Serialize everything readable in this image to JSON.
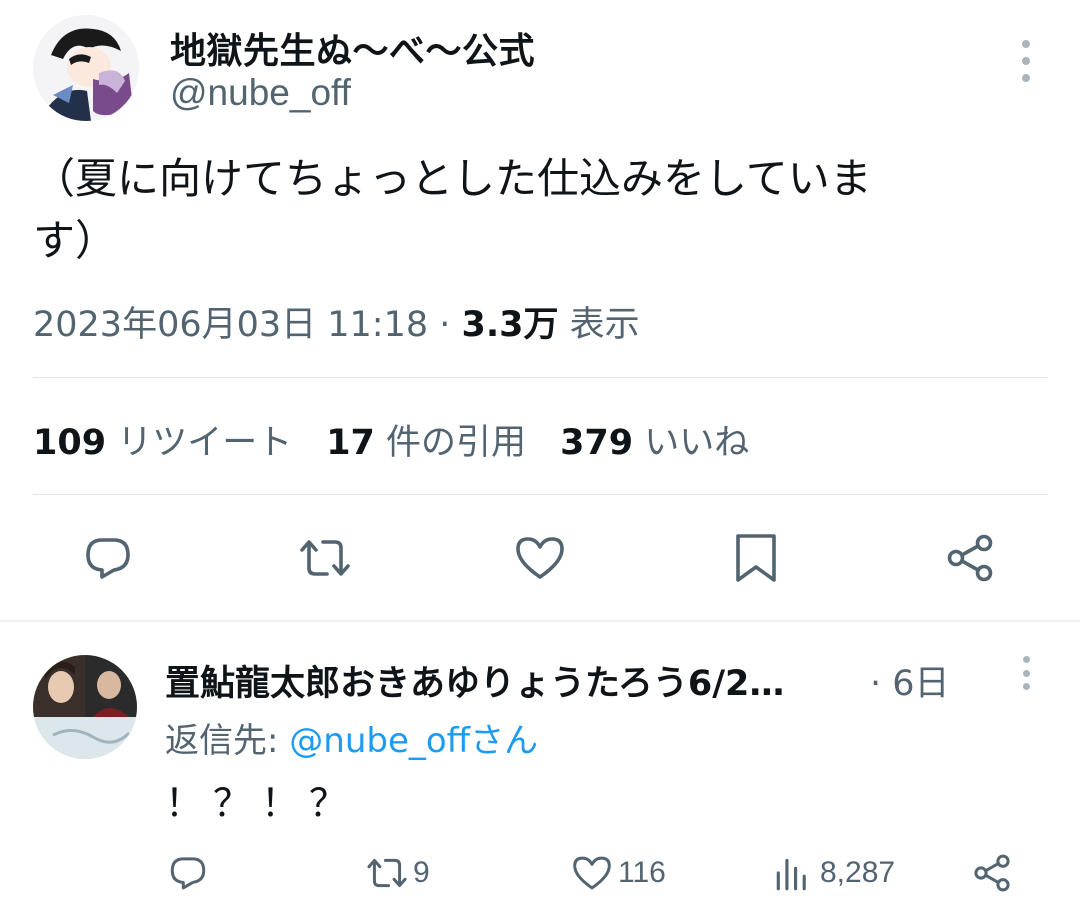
{
  "main_tweet": {
    "display_name": "地獄先生ぬ〜べ〜公式",
    "handle": "@nube_off",
    "text_line1": "（夏に向けてちょっとした仕込みをしていま",
    "text_line2": "す）",
    "datetime": "2023年06月03日 11:18",
    "separator": " · ",
    "views_count": "3.3万",
    "views_label": " 表示",
    "stats": {
      "retweets_count": "109",
      "retweets_label": " リツイート",
      "quotes_count": "17",
      "quotes_label": " 件の引用",
      "likes_count": "379",
      "likes_label": " いいね"
    },
    "actions": [
      "reply-icon",
      "retweet-icon",
      "like-icon",
      "bookmark-icon",
      "share-icon"
    ]
  },
  "reply_tweet": {
    "display_name": "置鮎龍太郎おきあゆりょうたろう6/2…",
    "time": " · 6日",
    "reply_to_label": "返信先: ",
    "reply_to_handle": "@nube_offさん",
    "text": "！？！？",
    "retweet_count": "9",
    "like_count": "116",
    "views_count": "8,287"
  },
  "colors": {
    "text_primary": "#0f1419",
    "text_secondary": "#536471",
    "link": "#1d9bf0",
    "divider": "#e1e6ea"
  }
}
